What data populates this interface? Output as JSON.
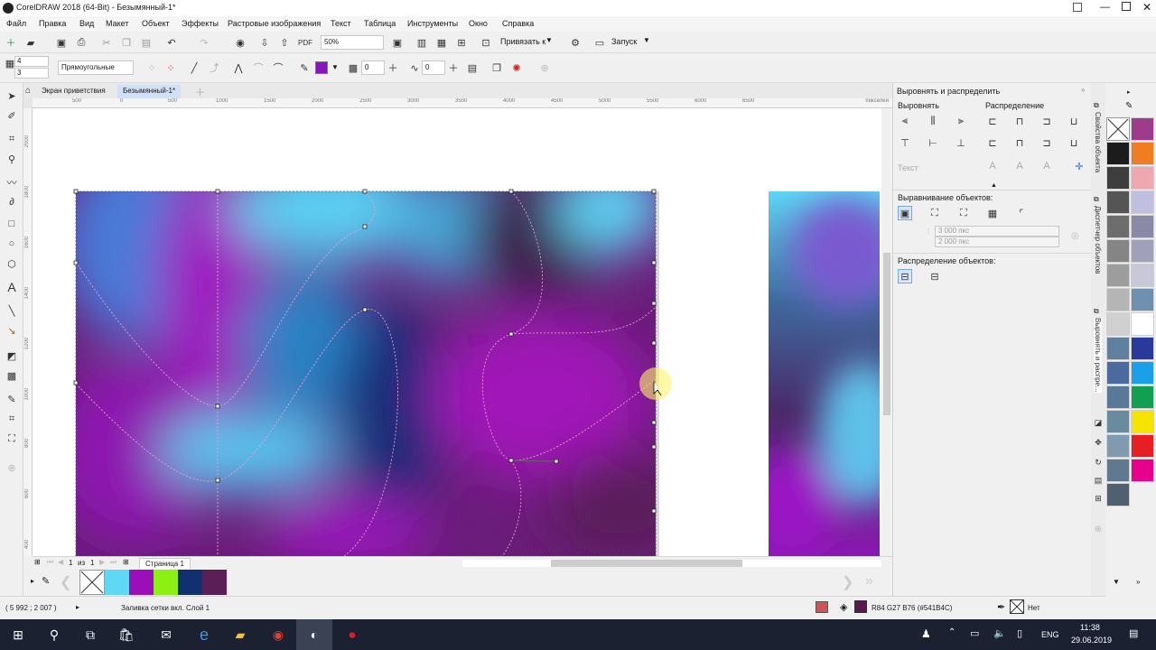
{
  "window": {
    "title": "CorelDRAW 2018 (64-Bit) - Безымянный-1*"
  },
  "menu": [
    "Файл",
    "Правка",
    "Вид",
    "Макет",
    "Объект",
    "Эффекты",
    "Растровые изображения",
    "Текст",
    "Таблица",
    "Инструменты",
    "Окно",
    "Справка"
  ],
  "toolbar": {
    "zoom": "50%",
    "snap_label": "Привязать к",
    "launch_label": "Запуск"
  },
  "propbar": {
    "rows_value": "4",
    "cols_value": "3",
    "mode_value": "Прямоугольные",
    "outline_value": "0",
    "thickness_value": "0",
    "fill_color": "#8a12c4"
  },
  "tabs": [
    {
      "label": "Экран приветствия"
    },
    {
      "label": "Безымянный-1*"
    }
  ],
  "ruler": {
    "h_ticks": [
      "500",
      "0",
      "500",
      "1000",
      "1500",
      "2000",
      "2500",
      "3000",
      "3500",
      "4000",
      "4500",
      "5000",
      "5500",
      "6000",
      "6500"
    ],
    "h_unit": "пикселей",
    "v_ticks": [
      "2000",
      "1800",
      "1600",
      "1400",
      "1200",
      "1000",
      "800",
      "600",
      "400"
    ]
  },
  "pagebar": {
    "page_num": "1",
    "of_label": "из",
    "total": "1",
    "page_label": "Страница 1"
  },
  "status": {
    "coords": "( 5 992 ; 2 007 )",
    "info": "Заливка сетки вкл. Слой 1",
    "fill_info": "R84 G27 B76 (#541B4C)",
    "outline_info": "Нет"
  },
  "docker": {
    "title": "Выровнять и распределить",
    "align_label": "Выровнять",
    "distribute_label": "Распределение",
    "text_label": "Текст",
    "align_objects_label": "Выравнивание объектов:",
    "x_value": "3 000 пкс",
    "y_value": "2 000 пкс",
    "distribute_objects_label": "Распределение объектов:"
  },
  "docker_tabs": [
    "Свойства объекта",
    "Диспетчер объектов",
    "Выровнять и распре..."
  ],
  "document_palette": {
    "colors": [
      "#5ed8f5",
      "#9a0fb8",
      "#8cf014",
      "#12306e",
      "#5a1f56"
    ]
  },
  "palette": {
    "colors": [
      "#9d3c8b",
      "#1c1c1c",
      "#f07d20",
      "#3d3d3d",
      "#f0a8b0",
      "#555555",
      "#bfbfe0",
      "#6d6d6d",
      "#8a8aa8",
      "#858585",
      "#a0a0b8",
      "#9d9d9d",
      "#c8c8d8",
      "#b5b5b5",
      "#7090b0",
      "#d0d0d0",
      "#ffffff",
      "#6080a0",
      "#2a3a9a",
      "#4a6aa0",
      "#1aa0e8",
      "#5a7898",
      "#10a050",
      "#6a8aa0",
      "#f4e400",
      "#809ab0",
      "#e81e25",
      "#607890",
      "#e8008c",
      "#506070"
    ]
  },
  "taskbar": {
    "lang": "ENG",
    "time": "11:38",
    "date": "29.06.2019"
  }
}
